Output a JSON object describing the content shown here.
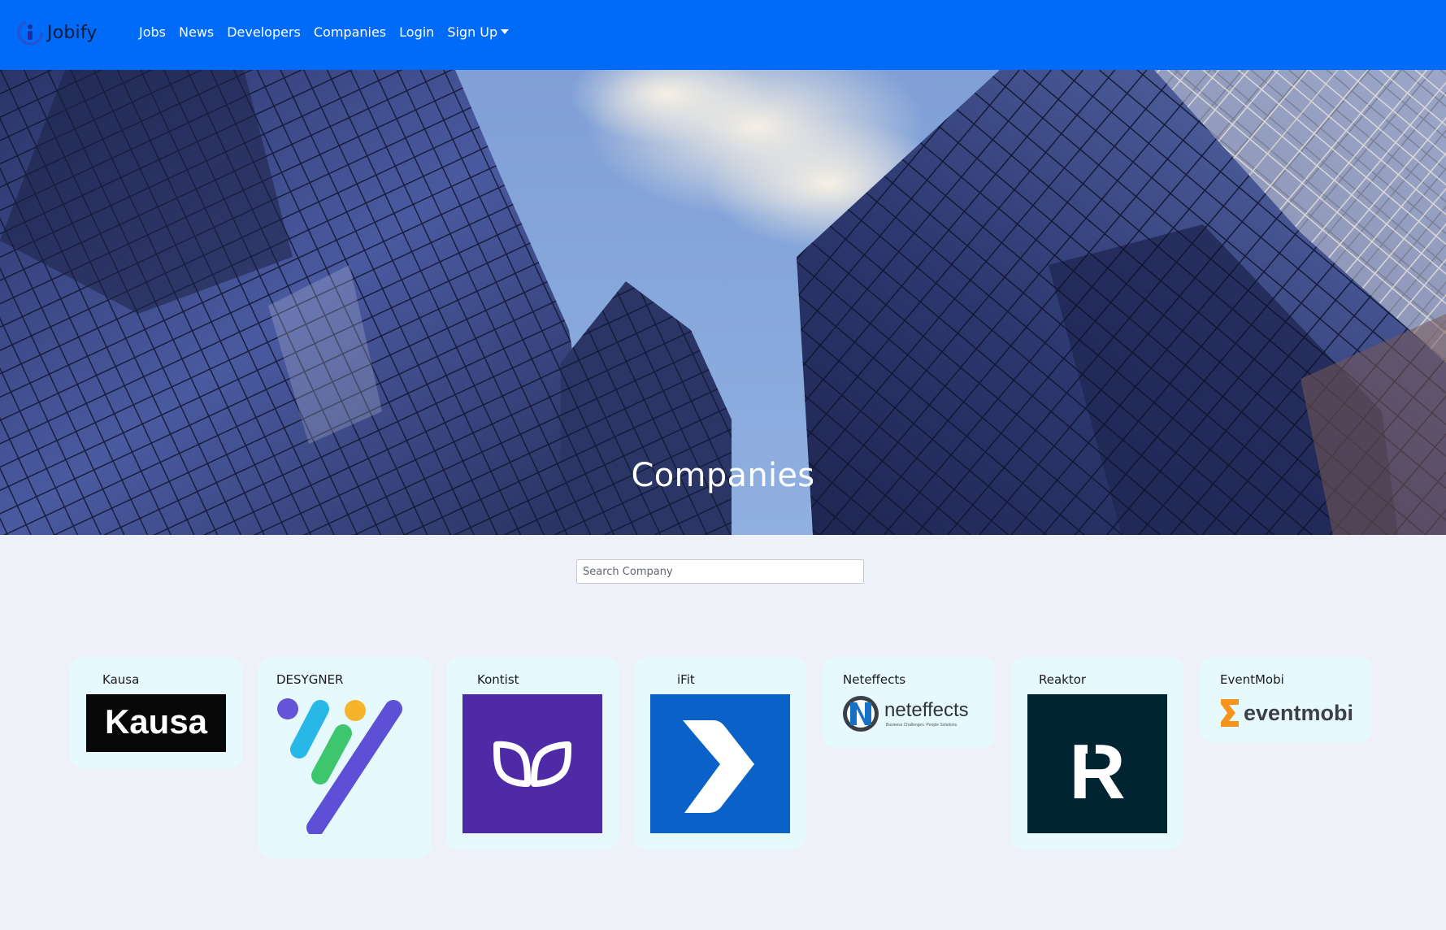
{
  "navbar": {
    "brand": "Jobify",
    "links": [
      "Jobs",
      "News",
      "Developers",
      "Companies",
      "Login",
      "Sign Up"
    ]
  },
  "hero": {
    "title": "Companies"
  },
  "search": {
    "placeholder": "Search Company",
    "value": ""
  },
  "companies": [
    {
      "name": "Kausa",
      "logo_text": "Kausa"
    },
    {
      "name": "DESYGNER"
    },
    {
      "name": "Kontist"
    },
    {
      "name": "iFit"
    },
    {
      "name": "Neteffects",
      "logo_text": "neteffects",
      "logo_tagline": "Business Challenges. People Solutions."
    },
    {
      "name": "Reaktor",
      "logo_text": "R"
    },
    {
      "name": "EventMobi",
      "logo_text": "eventmobi"
    }
  ],
  "colors": {
    "navbar": "#006bf8",
    "page_background": "#eff1f8",
    "card_background": "#e6f9fd",
    "kontist": "#4f2aa7",
    "ifit": "#0a62c8",
    "reaktor": "#012433"
  }
}
